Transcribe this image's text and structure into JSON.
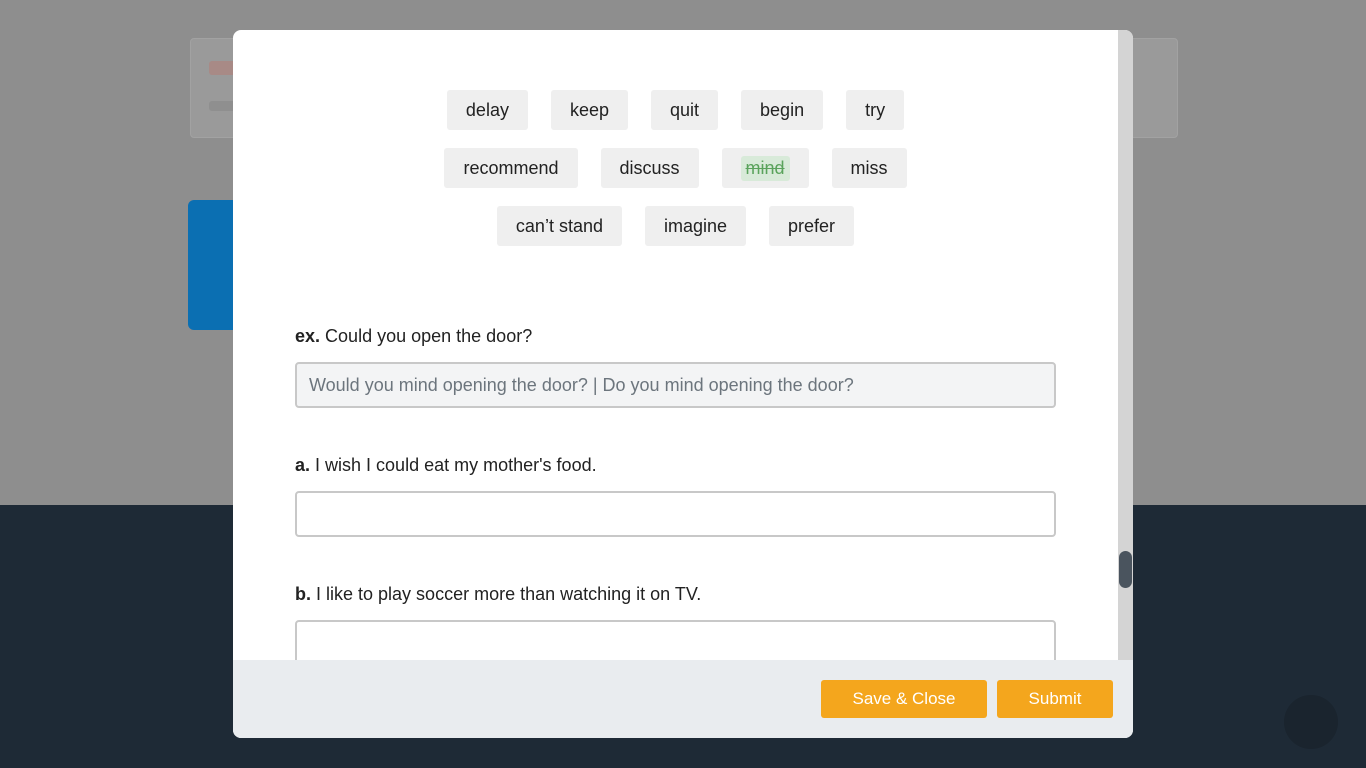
{
  "word_bank": {
    "rows": [
      [
        {
          "word": "delay"
        },
        {
          "word": "keep"
        },
        {
          "word": "quit"
        },
        {
          "word": "begin"
        },
        {
          "word": "try"
        }
      ],
      [
        {
          "word": "recommend"
        },
        {
          "word": "discuss"
        },
        {
          "word": "mind",
          "used": true
        },
        {
          "word": "miss"
        }
      ],
      [
        {
          "word": "can’t stand"
        },
        {
          "word": "imagine"
        },
        {
          "word": "prefer"
        }
      ]
    ]
  },
  "questions": {
    "example": {
      "label": "ex.",
      "prompt": "Could you open the door?",
      "answer": "Would you mind opening the door? | Do you mind opening the door?"
    },
    "a": {
      "label": "a.",
      "prompt": "I wish I could eat my mother's food.",
      "answer": ""
    },
    "b": {
      "label": "b.",
      "prompt": "I like to play soccer more than watching it on TV.",
      "answer": ""
    }
  },
  "footer": {
    "save_label": "Save & Close",
    "submit_label": "Submit"
  },
  "colors": {
    "accent": "#f4a61d",
    "used_word_bg": "#d8ead9",
    "used_word_text": "#5aa35c",
    "footer_bg": "#e9ecef"
  }
}
